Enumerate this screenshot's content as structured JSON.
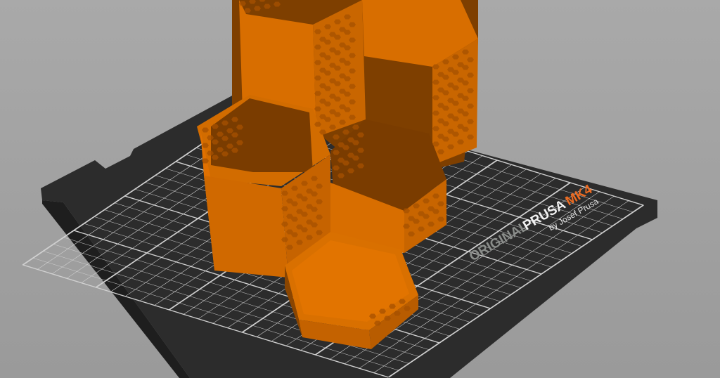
{
  "bed": {
    "logo_original": "ORIGINAL",
    "logo_prusa": "PRUSA",
    "logo_model": "MK4",
    "logo_byline": "by Josef Prusa"
  },
  "colors": {
    "background": "#a0a0a0",
    "bed_plate": "#2e2e2e",
    "grid": "#cfcfcf",
    "model_light": "#e07000",
    "model_dark": "#7a3c00",
    "accent": "#ed6b21"
  }
}
